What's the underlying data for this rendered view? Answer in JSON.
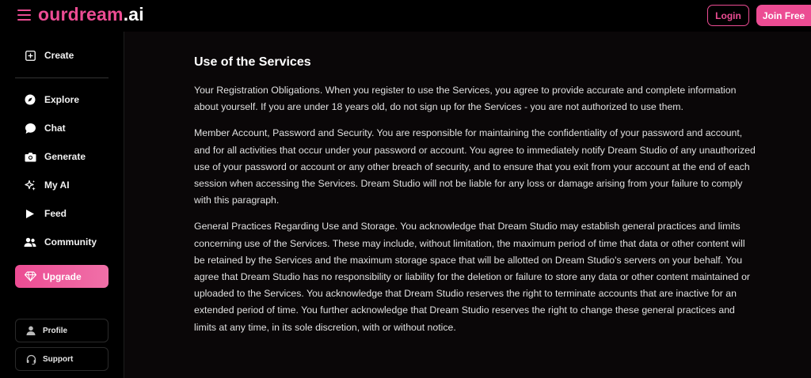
{
  "header": {
    "logo_brand": "ourdream",
    "logo_tld": ".ai",
    "login_label": "Login",
    "join_label": "Join Free"
  },
  "sidebar": {
    "create_label": "Create",
    "items": [
      {
        "label": "Explore",
        "icon": "compass-icon"
      },
      {
        "label": "Chat",
        "icon": "chat-bubble-icon"
      },
      {
        "label": "Generate",
        "icon": "camera-icon"
      },
      {
        "label": "My AI",
        "icon": "sparkle-icon"
      },
      {
        "label": "Feed",
        "icon": "play-icon"
      },
      {
        "label": "Community",
        "icon": "users-icon"
      }
    ],
    "upgrade_label": "Upgrade",
    "profile_label": "Profile",
    "support_label": "Support"
  },
  "main": {
    "heading": "Use of the Services",
    "paragraphs": [
      "Your Registration Obligations. When you register to use the Services, you agree to provide accurate and complete information about yourself. If you are under 18 years old, do not sign up for the Services - you are not authorized to use them.",
      "Member Account, Password and Security. You are responsible for maintaining the confidentiality of your password and account, and for all activities that occur under your password or account. You agree to immediately notify Dream Studio of any unauthorized use of your password or account or any other breach of security, and to ensure that you exit from your account at the end of each session when accessing the Services. Dream Studio will not be liable for any loss or damage arising from your failure to comply with this paragraph.",
      "General Practices Regarding Use and Storage. You acknowledge that Dream Studio may establish general practices and limits concerning use of the Services. These may include, without limitation, the maximum period of time that data or other content will be retained by the Services and the maximum storage space that will be allotted on Dream Studio's servers on your behalf. You agree that Dream Studio has no responsibility or liability for the deletion or failure to store any data or other content maintained or uploaded to the Services. You acknowledge that Dream Studio reserves the right to terminate accounts that are inactive for an extended period of time. You further acknowledge that Dream Studio reserves the right to change these general practices and limits at any time, in its sole discretion, with or without notice."
    ]
  },
  "colors": {
    "accent": "#ec4c93",
    "background": "#000000",
    "content_background": "#0a0708"
  }
}
